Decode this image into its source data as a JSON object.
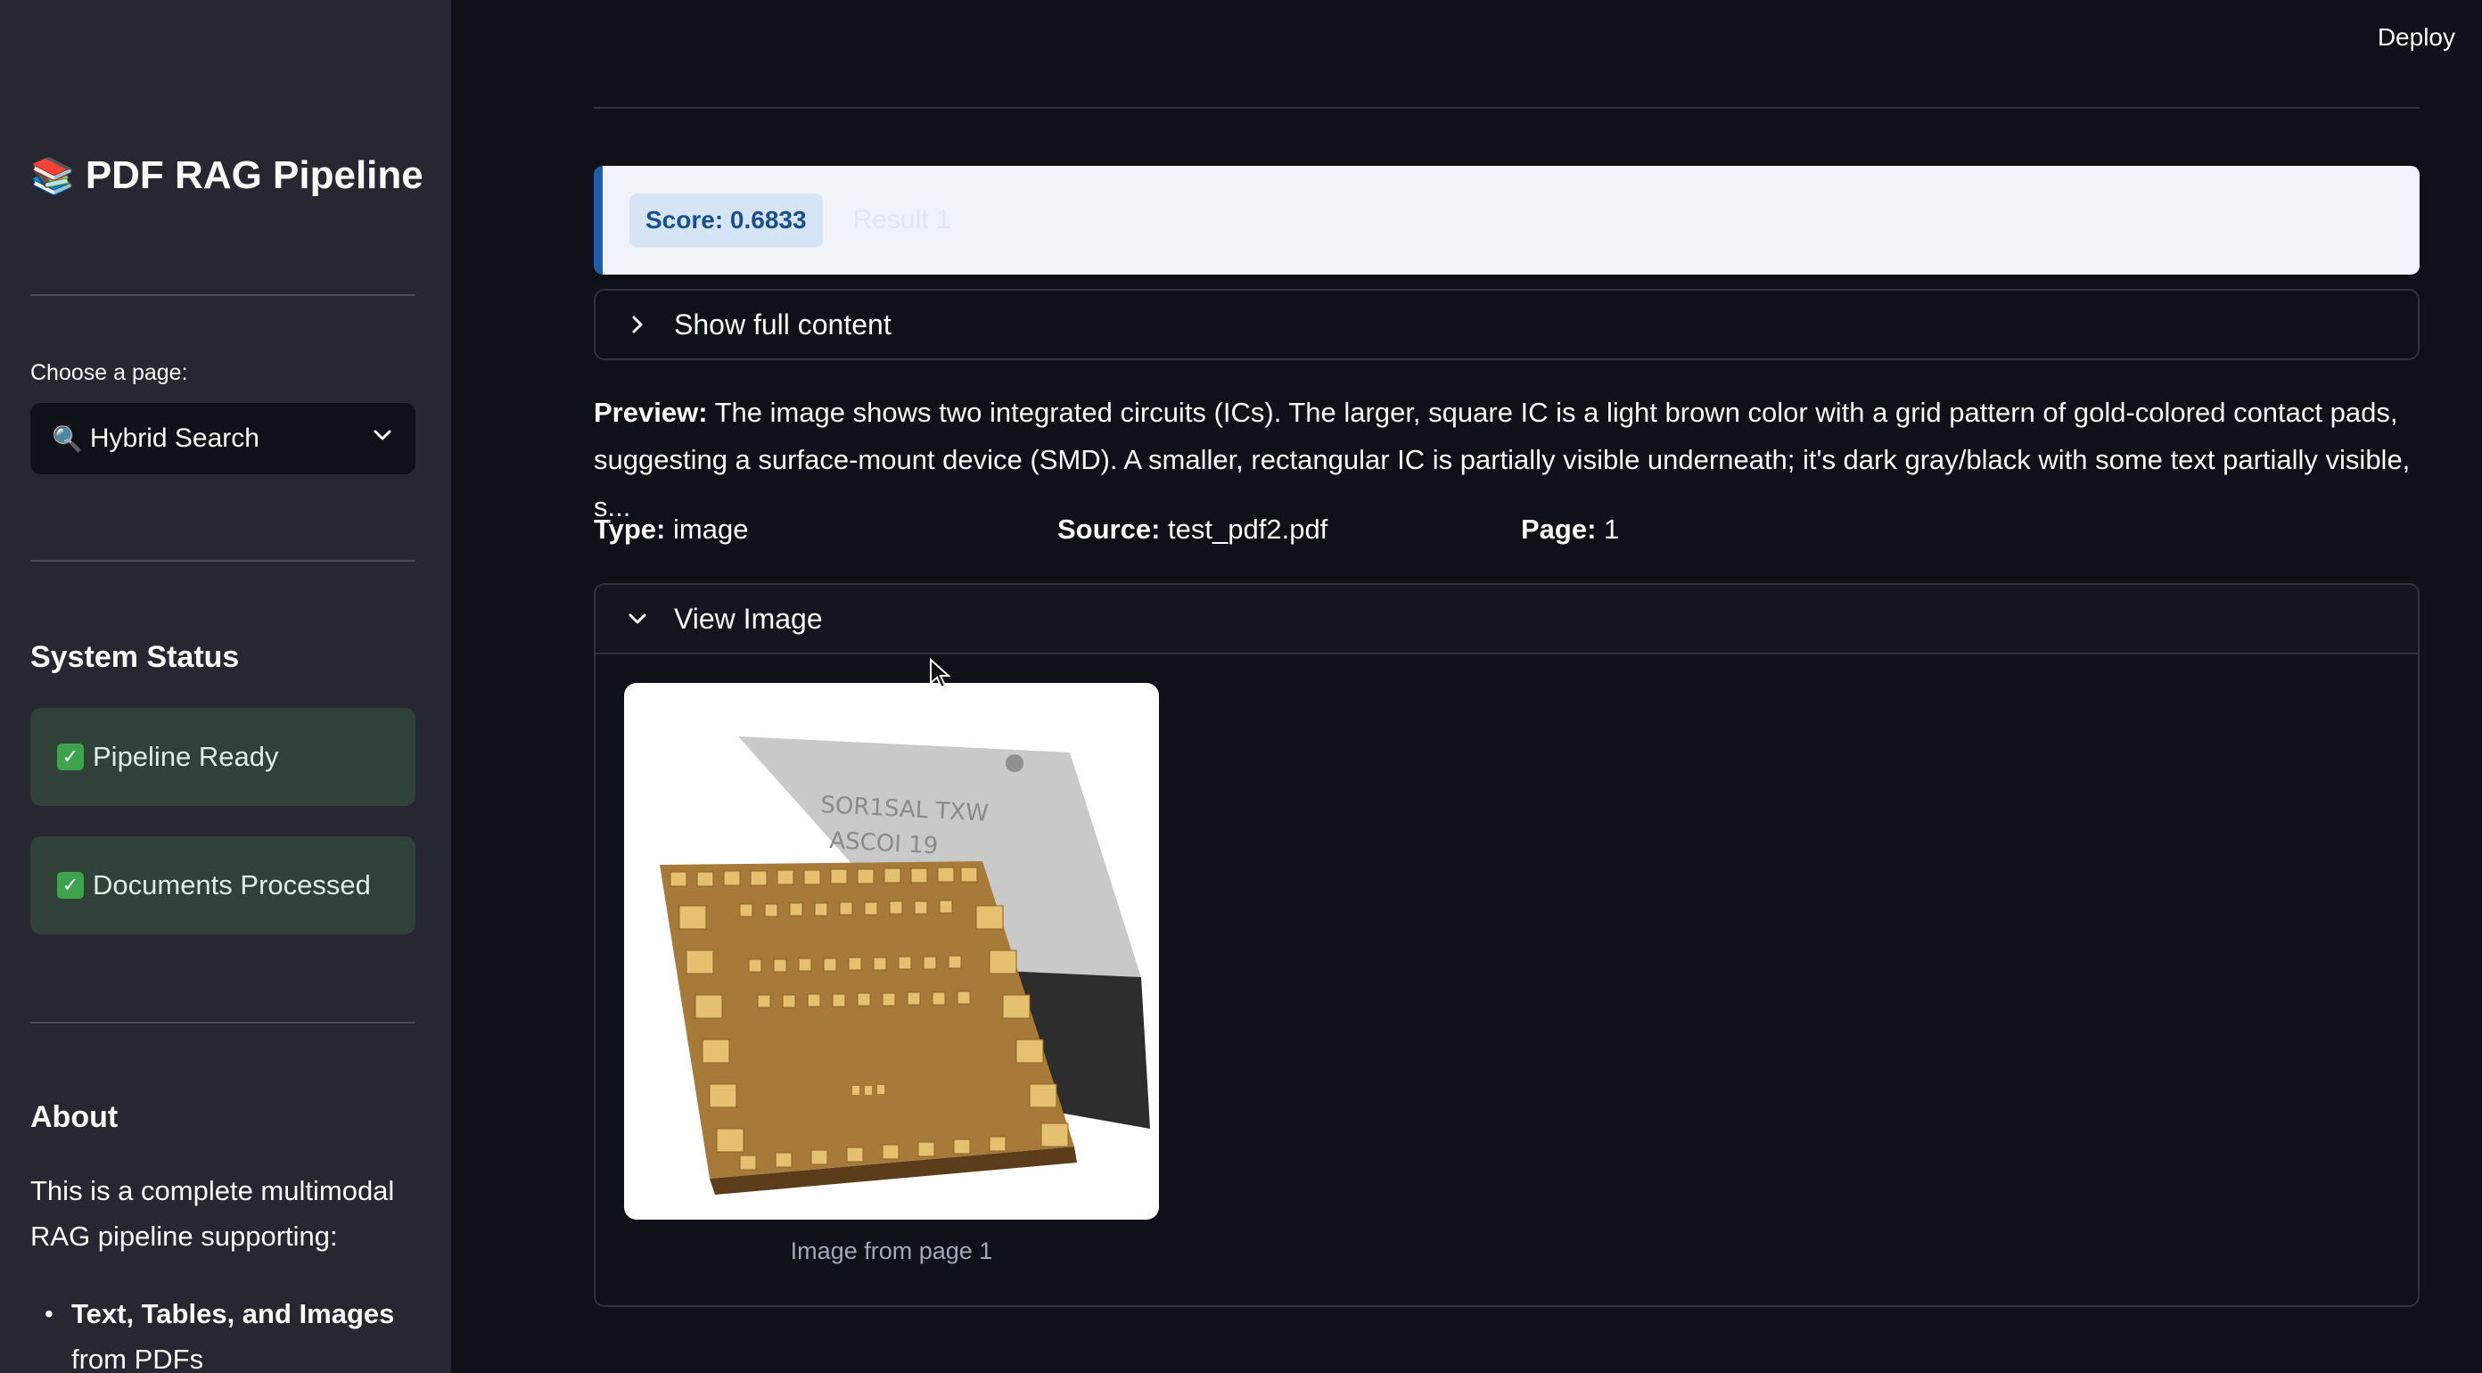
{
  "header": {
    "deploy_label": "Deploy"
  },
  "sidebar": {
    "title": "PDF RAG Pipeline",
    "title_icon": "books-icon",
    "select_label": "Choose a page:",
    "selected_page": "Hybrid Search",
    "system_status_heading": "System Status",
    "status_items": [
      {
        "label": "Pipeline Ready",
        "icon": "check-icon"
      },
      {
        "label": "Documents Processed",
        "icon": "check-icon"
      }
    ],
    "about_heading": "About",
    "about_text": "This is a complete multimodal RAG pipeline supporting:",
    "about_list": [
      {
        "bold": "Text, Tables, and Images",
        "rest": "from PDFs"
      }
    ]
  },
  "result": {
    "score": "Score: 0.6833",
    "label": "Result 1",
    "show_full_label": "Show full content",
    "preview_label": "Preview:",
    "preview_text": "The image shows two integrated circuits (ICs). The larger, square IC is a light brown color with a grid pattern of gold-colored contact pads, suggesting a surface-mount device (SMD). A smaller, rectangular IC is partially visible underneath; it's dark gray/black with some text partially visible, s...",
    "type_label": "Type:",
    "type_value": "image",
    "source_label": "Source:",
    "source_value": "test_pdf2.pdf",
    "page_label": "Page:",
    "page_value": "1",
    "view_image_label": "View Image",
    "image_caption": "Image from page 1",
    "chip_text_line1": "SOR1SAL TXW",
    "chip_text_line2": "ASCOI 19"
  },
  "colors": {
    "sidebar_bg": "#262730",
    "main_bg": "#0e1117",
    "status_bg": "#2f4138",
    "score_accent": "#1c5fa8"
  }
}
